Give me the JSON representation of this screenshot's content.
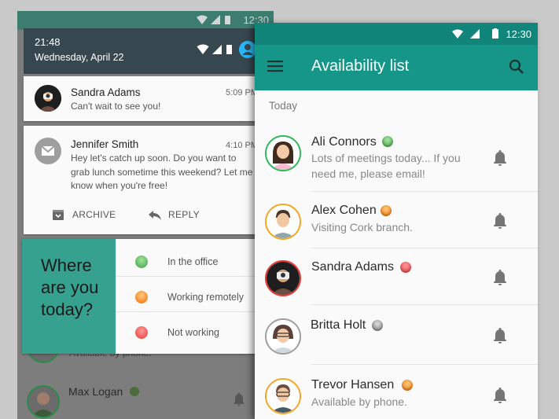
{
  "left_phone": {
    "status_time": "12:30",
    "shade": {
      "time": "21:48",
      "date": "Wednesday, April 22"
    },
    "notifications": [
      {
        "title": "Sandra Adams",
        "time": "5:09 PM",
        "body": "Can't wait to see you!"
      },
      {
        "title": "Jennifer Smith",
        "time": "4:10 PM",
        "body": "Hey let's catch up soon. Do you want to grab lunch sometime this weekend? Let me know when you're free!"
      }
    ],
    "actions": {
      "archive": "ARCHIVE",
      "reply": "REPLY"
    },
    "where": {
      "prompt": "Where are you today?",
      "options": [
        {
          "label": "In the office",
          "color": "#4caf50"
        },
        {
          "label": "Working remotely",
          "color": "#ff9800"
        },
        {
          "label": "Not working",
          "color": "#f44336"
        }
      ]
    },
    "background_list": {
      "sub": "Available by phone.",
      "name": "Max Logan"
    }
  },
  "right_phone": {
    "status_time": "12:30",
    "title": "Availability list",
    "section": "Today",
    "contacts": [
      {
        "name": "Ali Connors",
        "sub": "Lots of meetings today... If you need me, please email!",
        "status_color": "#4caf50",
        "ring": "#2eb85c"
      },
      {
        "name": "Alex Cohen",
        "sub": "Visiting Cork branch.",
        "status_color": "#ff9800",
        "ring": "#f5a623"
      },
      {
        "name": "Sandra Adams",
        "sub": "",
        "status_color": "#f44336",
        "ring": "#e53935"
      },
      {
        "name": "Britta Holt",
        "sub": "",
        "status_color": "#9e9e9e",
        "ring": "#9e9e9e"
      },
      {
        "name": "Trevor Hansen",
        "sub": "Available by phone.",
        "status_color": "#ff9800",
        "ring": "#f5a623"
      }
    ]
  },
  "colors": {
    "teal": "#169688",
    "teal_dark": "#11857a",
    "panel_green": "#36a18e"
  }
}
